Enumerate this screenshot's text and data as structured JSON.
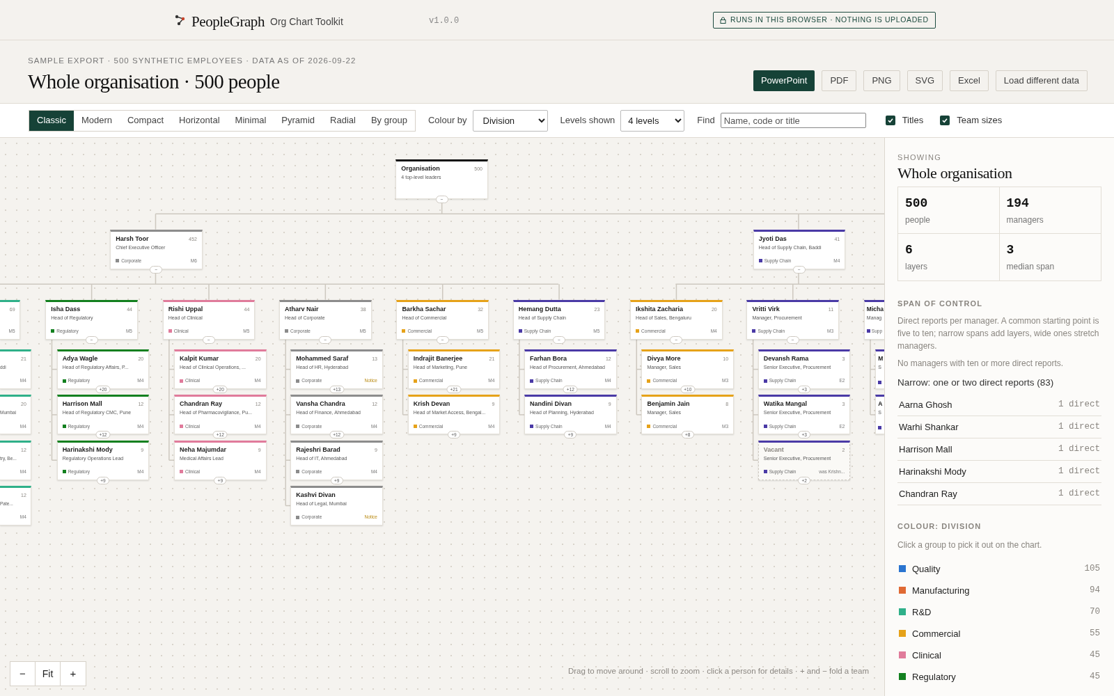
{
  "topbar": {
    "brand": "PeopleGraph",
    "product": "Org Chart Toolkit",
    "version": "v1.0.0",
    "badge": "RUNS IN THIS BROWSER · NOTHING IS UPLOADED"
  },
  "header": {
    "eyebrow": "SAMPLE EXPORT · 500 SYNTHETIC EMPLOYEES · DATA AS OF 2026-09-22",
    "title": "Whole organisation · 500 people",
    "exports": [
      {
        "label": "PowerPoint",
        "kind": "primary"
      },
      {
        "label": "PDF",
        "kind": "secondary"
      },
      {
        "label": "PNG",
        "kind": "secondary"
      },
      {
        "label": "SVG",
        "kind": "secondary"
      },
      {
        "label": "Excel",
        "kind": "secondary"
      },
      {
        "label": "Load different data",
        "kind": "secondary"
      }
    ]
  },
  "toolbar": {
    "layouts": [
      {
        "label": "Classic",
        "selected": true
      },
      {
        "label": "Modern",
        "selected": false
      },
      {
        "label": "Compact",
        "selected": false
      },
      {
        "label": "Horizontal",
        "selected": false
      },
      {
        "label": "Minimal",
        "selected": false
      },
      {
        "label": "Pyramid",
        "selected": false
      },
      {
        "label": "Radial",
        "selected": false
      },
      {
        "label": "By group",
        "selected": false
      }
    ],
    "colour_by": {
      "label": "Colour by",
      "value": "Division"
    },
    "levels": {
      "label": "Levels shown",
      "value": "4 levels"
    },
    "find": {
      "label": "Find",
      "placeholder": "Name, code or title"
    },
    "toggles": [
      {
        "label": "Titles",
        "checked": true
      },
      {
        "label": "Team sizes",
        "checked": true
      }
    ]
  },
  "chart": {
    "root": {
      "name": "Organisation",
      "title": "4 top-level leaders",
      "count": "500",
      "toggle": "−"
    },
    "leaders": [
      {
        "name": "Harsh Toor",
        "title": "Chief Executive Officer",
        "count": "452",
        "division": "Corporate",
        "color": "#8c8c8c",
        "grade": "M6",
        "toggle": "−",
        "cut_report": {
          "count": "69",
          "grade": "M5",
          "color": "#2fb089",
          "children": [
            {
              "title": "ddi",
              "count": "21",
              "grade": "M4"
            },
            {
              "title": "Mumbai",
              "count": "20",
              "grade": "M4"
            },
            {
              "title": "try, Be...",
              "count": "12",
              "grade": "M4"
            },
            {
              "title": "Pate...",
              "count": "12",
              "grade": "M4"
            }
          ]
        },
        "reports": [
          {
            "name": "Isha Dass",
            "title": "Head of Regulatory",
            "count": "44",
            "division": "Regulatory",
            "color": "#13801f",
            "grade": "M5",
            "toggle": "−",
            "children": [
              {
                "name": "Adya Wagle",
                "title": "Head of Regulatory Affairs, P...",
                "count": "20",
                "division": "Regulatory",
                "color": "#13801f",
                "grade": "M4",
                "toggle": "+20",
                "notice": false,
                "vacant": false
              },
              {
                "name": "Harrison Mall",
                "title": "Head of Regulatory CMC, Pune",
                "count": "12",
                "division": "Regulatory",
                "color": "#13801f",
                "grade": "M4",
                "toggle": "+12",
                "notice": false,
                "vacant": false
              },
              {
                "name": "Harinakshi Mody",
                "title": "Regulatory Operations Lead",
                "count": "9",
                "division": "Regulatory",
                "color": "#13801f",
                "grade": "M4",
                "toggle": "+9",
                "notice": false,
                "vacant": false
              }
            ]
          },
          {
            "name": "Rishi Uppal",
            "title": "Head of Clinical",
            "count": "44",
            "division": "Clinical",
            "color": "#e07b9b",
            "grade": "M5",
            "toggle": "−",
            "children": [
              {
                "name": "Kalpit Kumar",
                "title": "Head of Clinical Operations, ...",
                "count": "20",
                "division": "Clinical",
                "color": "#e07b9b",
                "grade": "M4",
                "toggle": "+20",
                "notice": false,
                "vacant": false
              },
              {
                "name": "Chandran Ray",
                "title": "Head of Pharmacovigilance, Pu...",
                "count": "12",
                "division": "Clinical",
                "color": "#e07b9b",
                "grade": "M4",
                "toggle": "+12",
                "notice": false,
                "vacant": false
              },
              {
                "name": "Neha Majumdar",
                "title": "Medical Affairs Lead",
                "count": "9",
                "division": "Clinical",
                "color": "#e07b9b",
                "grade": "M4",
                "toggle": "+9",
                "notice": false,
                "vacant": false
              }
            ]
          },
          {
            "name": "Atharv Nair",
            "title": "Head of Corporate",
            "count": "38",
            "division": "Corporate",
            "color": "#8c8c8c",
            "grade": "M5",
            "toggle": "−",
            "children": [
              {
                "name": "Mohammed Saraf",
                "title": "Head of HR, Hyderabad",
                "count": "13",
                "division": "Corporate",
                "color": "#8c8c8c",
                "grade": "Notice",
                "toggle": "+13",
                "notice": true,
                "vacant": false
              },
              {
                "name": "Vansha Chandra",
                "title": "Head of Finance, Ahmedabad",
                "count": "12",
                "division": "Corporate",
                "color": "#8c8c8c",
                "grade": "M4",
                "toggle": "+12",
                "notice": false,
                "vacant": false
              },
              {
                "name": "Rajeshri Barad",
                "title": "Head of IT, Ahmedabad",
                "count": "9",
                "division": "Corporate",
                "color": "#8c8c8c",
                "grade": "M4",
                "toggle": "+9",
                "notice": false,
                "vacant": false
              },
              {
                "name": "Kashvi Divan",
                "title": "Head of Legal, Mumbai",
                "division": "Corporate",
                "color": "#8c8c8c",
                "grade": "Notice",
                "notice": true,
                "vacant": false
              }
            ]
          },
          {
            "name": "Barkha Sachar",
            "title": "Head of Commercial",
            "count": "32",
            "division": "Commercial",
            "color": "#e6a219",
            "grade": "M5",
            "toggle": "−",
            "children": [
              {
                "name": "Indrajit Banerjee",
                "title": "Head of Marketing, Pune",
                "count": "21",
                "division": "Commercial",
                "color": "#e6a219",
                "grade": "M4",
                "toggle": "+21",
                "notice": false,
                "vacant": false
              },
              {
                "name": "Krish Devan",
                "title": "Head of Market Access, Bengal...",
                "count": "9",
                "division": "Commercial",
                "color": "#e6a219",
                "grade": "M4",
                "toggle": "+9",
                "notice": false,
                "vacant": false
              }
            ]
          },
          {
            "name": "Hemang Dutta",
            "title": "Head of Supply Chain",
            "count": "23",
            "division": "Supply Chain",
            "color": "#4a3aa6",
            "grade": "M5",
            "toggle": "−",
            "children": [
              {
                "name": "Farhan Bora",
                "title": "Head of Procurement, Ahmedabad",
                "count": "12",
                "division": "Supply Chain",
                "color": "#4a3aa6",
                "grade": "M4",
                "toggle": "+12",
                "notice": false,
                "vacant": false
              },
              {
                "name": "Nandini Divan",
                "title": "Head of Planning, Hyderabad",
                "count": "9",
                "division": "Supply Chain",
                "color": "#4a3aa6",
                "grade": "M4",
                "toggle": "+9",
                "notice": false,
                "vacant": false
              }
            ]
          }
        ]
      },
      {
        "name": "Jyoti Das",
        "title": "Head of Supply Chain, Baddi",
        "count": "41",
        "division": "Supply Chain",
        "color": "#4a3aa6",
        "grade": "M4",
        "toggle": "−",
        "reports": [
          {
            "name": "Ikshita Zacharia",
            "title": "Head of Sales, Bengaluru",
            "count": "20",
            "division": "Commercial",
            "color": "#e6a219",
            "grade": "M4",
            "toggle": "−",
            "children": [
              {
                "name": "Divya More",
                "title": "Manager, Sales",
                "count": "10",
                "division": "Commercial",
                "color": "#e6a219",
                "grade": "M3",
                "toggle": "+10",
                "notice": false,
                "vacant": false
              },
              {
                "name": "Benjamin Jain",
                "title": "Manager, Sales",
                "count": "8",
                "division": "Commercial",
                "color": "#e6a219",
                "grade": "M3",
                "toggle": "+8",
                "notice": false,
                "vacant": false
              }
            ]
          },
          {
            "name": "Vritti Virk",
            "title": "Manager, Procurement",
            "count": "11",
            "division": "Supply Chain",
            "color": "#4a3aa6",
            "grade": "M3",
            "toggle": "−",
            "children": [
              {
                "name": "Devansh Rama",
                "title": "Senior Executive, Procurement",
                "count": "3",
                "division": "Supply Chain",
                "color": "#4a3aa6",
                "grade": "E2",
                "toggle": "+3",
                "notice": false,
                "vacant": false
              },
              {
                "name": "Watika Mangal",
                "title": "Senior Executive, Procurement",
                "count": "3",
                "division": "Supply Chain",
                "color": "#4a3aa6",
                "grade": "E2",
                "toggle": "+3",
                "notice": false,
                "vacant": false
              },
              {
                "name": "Vacant",
                "title": "Senior Executive, Procurement",
                "count": "2",
                "division": "Supply Chain",
                "color": "#4a3aa6",
                "grade": "was Krishn...",
                "toggle": "+2",
                "notice": false,
                "vacant": true
              }
            ]
          }
        ],
        "cut_report": {
          "name": "Micha",
          "title": "Manag",
          "division": "Supp",
          "color": "#4a3aa6",
          "children": [
            {
              "name": "M",
              "title": "S",
              "color": "#4a3aa6"
            },
            {
              "name": "A",
              "title": "S",
              "color": "#4a3aa6"
            }
          ]
        }
      }
    ]
  },
  "zoom": {
    "out": "−",
    "fit": "Fit",
    "in": "+"
  },
  "hint": "Drag to move around · scroll to zoom · click a person for details · + and − fold a team",
  "sidebar": {
    "label": "SHOWING",
    "title": "Whole organisation",
    "stats": [
      {
        "value": "500",
        "label": "people"
      },
      {
        "value": "194",
        "label": "managers"
      },
      {
        "value": "6",
        "label": "layers"
      },
      {
        "value": "3",
        "label": "median span"
      }
    ],
    "span": {
      "heading": "SPAN OF CONTROL",
      "description": "Direct reports per manager. A common starting point is five to ten; narrow spans add layers, wide ones stretch managers.",
      "note": "No managers with ten or more direct reports.",
      "narrow": "Narrow: one or two direct reports (83)",
      "people": [
        {
          "name": "Aarna Ghosh",
          "reports": "1 direct"
        },
        {
          "name": "Warhi Shankar",
          "reports": "1 direct"
        },
        {
          "name": "Harrison Mall",
          "reports": "1 direct"
        },
        {
          "name": "Harinakshi Mody",
          "reports": "1 direct"
        },
        {
          "name": "Chandran Ray",
          "reports": "1 direct"
        }
      ]
    },
    "legend": {
      "heading": "COLOUR: DIVISION",
      "hint": "Click a group to pick it out on the chart.",
      "items": [
        {
          "name": "Quality",
          "count": "105",
          "color": "#2a74d0"
        },
        {
          "name": "Manufacturing",
          "count": "94",
          "color": "#e06a34"
        },
        {
          "name": "R&D",
          "count": "70",
          "color": "#2fb089"
        },
        {
          "name": "Commercial",
          "count": "55",
          "color": "#e6a219"
        },
        {
          "name": "Clinical",
          "count": "45",
          "color": "#e07b9b"
        },
        {
          "name": "Regulatory",
          "count": "45",
          "color": "#13801f"
        }
      ]
    }
  }
}
